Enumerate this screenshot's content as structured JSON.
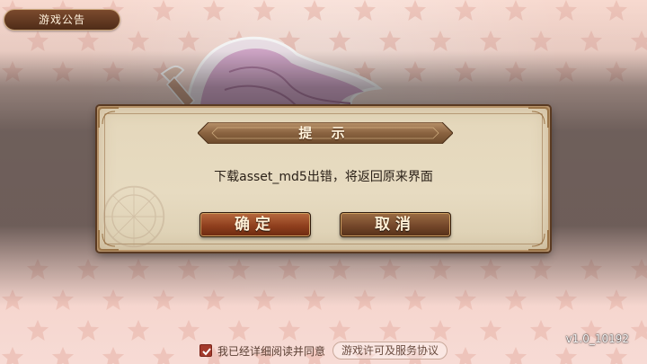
{
  "notice_button": {
    "label": "游戏公告"
  },
  "dialog": {
    "title": "提 示",
    "message": "下载asset_md5出错，将返回原来界面",
    "confirm_label": "确定",
    "cancel_label": "取消"
  },
  "footer": {
    "agree_text": "我已经详细阅读并同意",
    "agree_checked": true,
    "license_link": "游戏许可及服务协议",
    "version": "v1.0_10192"
  },
  "colors": {
    "background": "#f6d8cf",
    "dialog_bg": "#e4d7bb",
    "confirm_button": "#8f3f1e",
    "cancel_button": "#74472a",
    "checkbox": "#a33a2c"
  }
}
